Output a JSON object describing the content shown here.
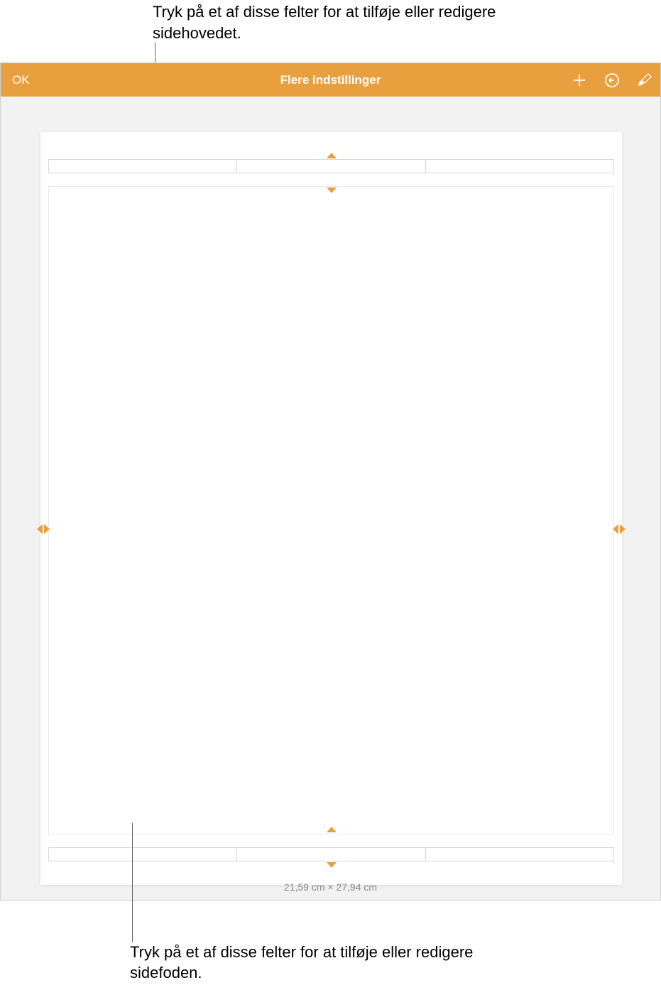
{
  "callouts": {
    "top": "Tryk på et af disse felter for at tilføje eller redigere sidehovedet.",
    "bottom": "Tryk på et af disse felter for at tilføje eller redigere sidefoden."
  },
  "toolbar": {
    "ok_label": "OK",
    "title": "Flere indstillinger",
    "icons": {
      "add": "plus-icon",
      "undo": "undo-icon",
      "brush": "brush-icon"
    }
  },
  "page": {
    "dimensions": "21,59 cm × 27,94 cm"
  },
  "colors": {
    "accent": "#e8a03e",
    "border": "#d8d8d8"
  }
}
